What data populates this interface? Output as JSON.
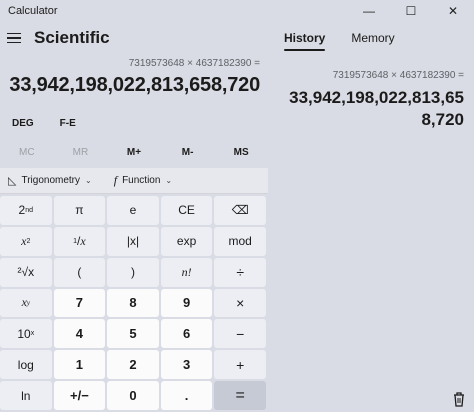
{
  "window": {
    "title": "Calculator",
    "minimize": "—",
    "maximize": "☐",
    "close": "✕"
  },
  "header": {
    "mode": "Scientific"
  },
  "display": {
    "expression": "7319573648 × 4637182390 =",
    "result": "33,942,198,022,813,658,720"
  },
  "modes": {
    "angle": "DEG",
    "notation": "F-E"
  },
  "memory": [
    "MC",
    "MR",
    "M+",
    "M-",
    "MS"
  ],
  "functions": {
    "trig": "Trigonometry",
    "func": "Function"
  },
  "keys": {
    "r1": {
      "second": "2",
      "second_sup": "nd",
      "pi": "π",
      "e": "e",
      "ce": "CE",
      "back": "⌫"
    },
    "r2": {
      "x": "x",
      "square_sup": "2",
      "recip_num": "1",
      "recip_den": "x",
      "abs": "|x|",
      "exp": "exp",
      "mod": "mod"
    },
    "r3": {
      "sqrt": "²√x",
      "lparen": "(",
      "rparen": ")",
      "fact": "n!",
      "div": "÷"
    },
    "r4": {
      "pow": "x",
      "pow_sup": "y",
      "n7": "7",
      "n8": "8",
      "n9": "9",
      "mul": "×"
    },
    "r5": {
      "ten": "10",
      "ten_sup": "x",
      "n4": "4",
      "n5": "5",
      "n6": "6",
      "minus": "−"
    },
    "r6": {
      "log": "log",
      "n1": "1",
      "n2": "2",
      "n3": "3",
      "plus": "+"
    },
    "r7": {
      "ln": "ln",
      "negate": "+/−",
      "n0": "0",
      "dot": ".",
      "eq": "="
    }
  },
  "history_panel": {
    "tabs": [
      "History",
      "Memory"
    ],
    "items": [
      {
        "expression": "7319573648   ×   4637182390 =",
        "result_line1": "33,942,198,022,813,65",
        "result_line2": "8,720"
      }
    ]
  }
}
